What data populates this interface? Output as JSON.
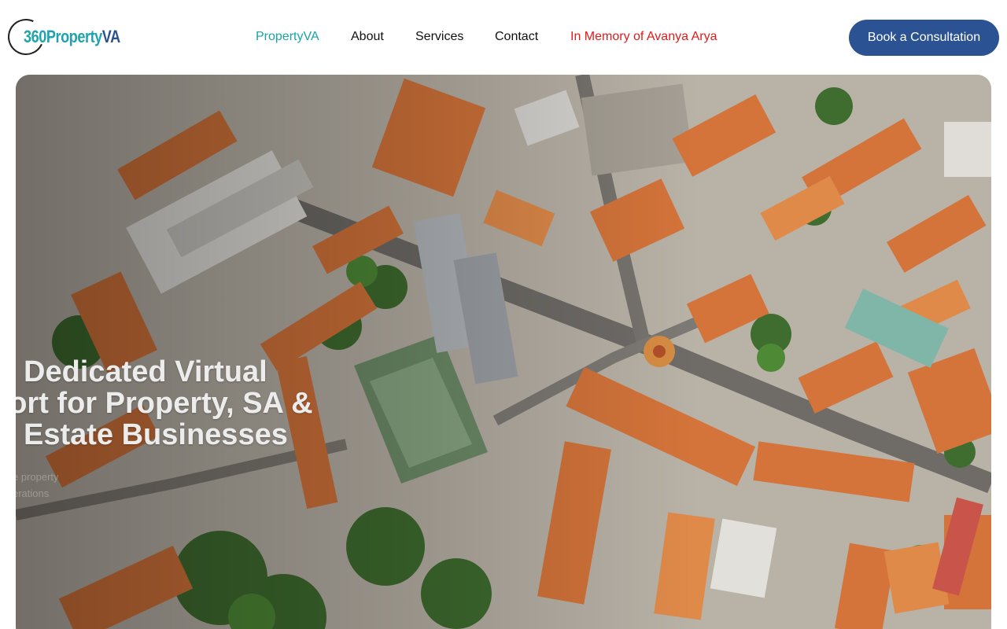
{
  "header": {
    "logo": {
      "part1": "360",
      "part2": "Property",
      "part3": "VA"
    },
    "nav": [
      {
        "label": "PropertyVA",
        "state": "active"
      },
      {
        "label": "About",
        "state": ""
      },
      {
        "label": "Services",
        "state": ""
      },
      {
        "label": "Contact",
        "state": ""
      },
      {
        "label": "In Memory of Avanya Arya",
        "state": "memorial"
      }
    ],
    "cta_label": "Book a Consultation"
  },
  "hero": {
    "headline_line1": "Dedicated Virtual",
    "headline_line2_bold": "port",
    "headline_line2_rest": " for Property, SA &",
    "headline_line3": "Estate Businesses",
    "subtext_line1": "e property",
    "subtext_line2": "erations"
  },
  "colors": {
    "accent_teal": "#1aa3a8",
    "brand_blue": "#2b5293",
    "memorial_red": "#e01b1b"
  },
  "icons": [
    "logo-ring-icon"
  ]
}
